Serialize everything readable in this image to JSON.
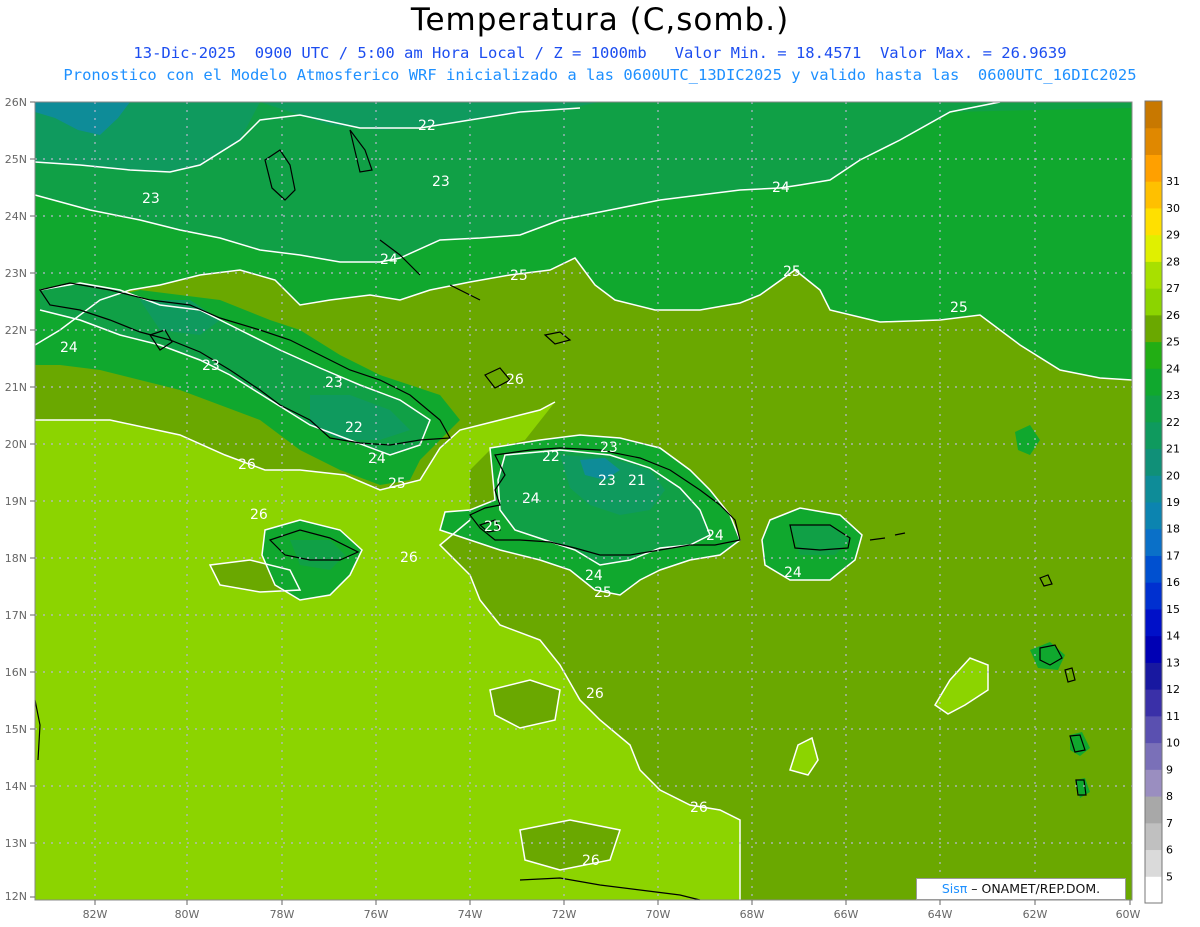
{
  "title": "Temperatura (C,somb.)",
  "subtitle_line1": "13-Dic-2025  0900 UTC / 5:00 am Hora Local / Z = 1000mb   Valor Min. = 18.4571  Valor Max. = 26.9639",
  "subtitle_line2": "Pronostico con el Modelo Atmosferico WRF inicializado a las 0600UTC_13DIC2025 y valido hasta las  0600UTC_16DIC2025",
  "lat_labels": [
    "26N",
    "25N",
    "24N",
    "23N",
    "22N",
    "21N",
    "20N",
    "19N",
    "18N",
    "17N",
    "16N",
    "15N",
    "14N",
    "13N",
    "12N"
  ],
  "lon_labels": [
    "82W",
    "80W",
    "78W",
    "76W",
    "74W",
    "72W",
    "70W",
    "68W",
    "66W",
    "64W",
    "62W",
    "60W"
  ],
  "colorbar": {
    "labels": [
      "5",
      "6",
      "7",
      "8",
      "9",
      "10",
      "11",
      "12",
      "13",
      "14",
      "15",
      "16",
      "17",
      "18",
      "19",
      "20",
      "21",
      "22",
      "23",
      "24",
      "25",
      "26",
      "27",
      "28",
      "29",
      "30",
      "31"
    ],
    "colors": [
      "#ffffff",
      "#dadada",
      "#c0c0c0",
      "#a8a8a8",
      "#9a8ec0",
      "#7a70b8",
      "#5a50b0",
      "#3a30a8",
      "#1818a0",
      "#0000b4",
      "#0010c8",
      "#0030d0",
      "#0050d0",
      "#0a70c8",
      "#0c84b0",
      "#0e8c98",
      "#109078",
      "#0f9a5e",
      "#10a046",
      "#10a82e",
      "#22ae14",
      "#6aa800",
      "#8cd400",
      "#a8e000",
      "#e0f000",
      "#ffe000",
      "#ffc000",
      "#ffa000",
      "#e08800",
      "#c87800"
    ]
  },
  "contour_labels": [
    "22",
    "23",
    "24",
    "25",
    "26",
    "21"
  ],
  "credit": {
    "brand": "Sisπ",
    "text": " – ONAMET/REP.DOM."
  },
  "colors": {
    "t22": "#0f9a5e",
    "t23": "#10a046",
    "t24": "#10a82e",
    "t25": "#6aa800",
    "t26": "#8cd400",
    "title": "#000000",
    "subtitle1": "#1c4df0",
    "subtitle2": "#1e90ff"
  }
}
